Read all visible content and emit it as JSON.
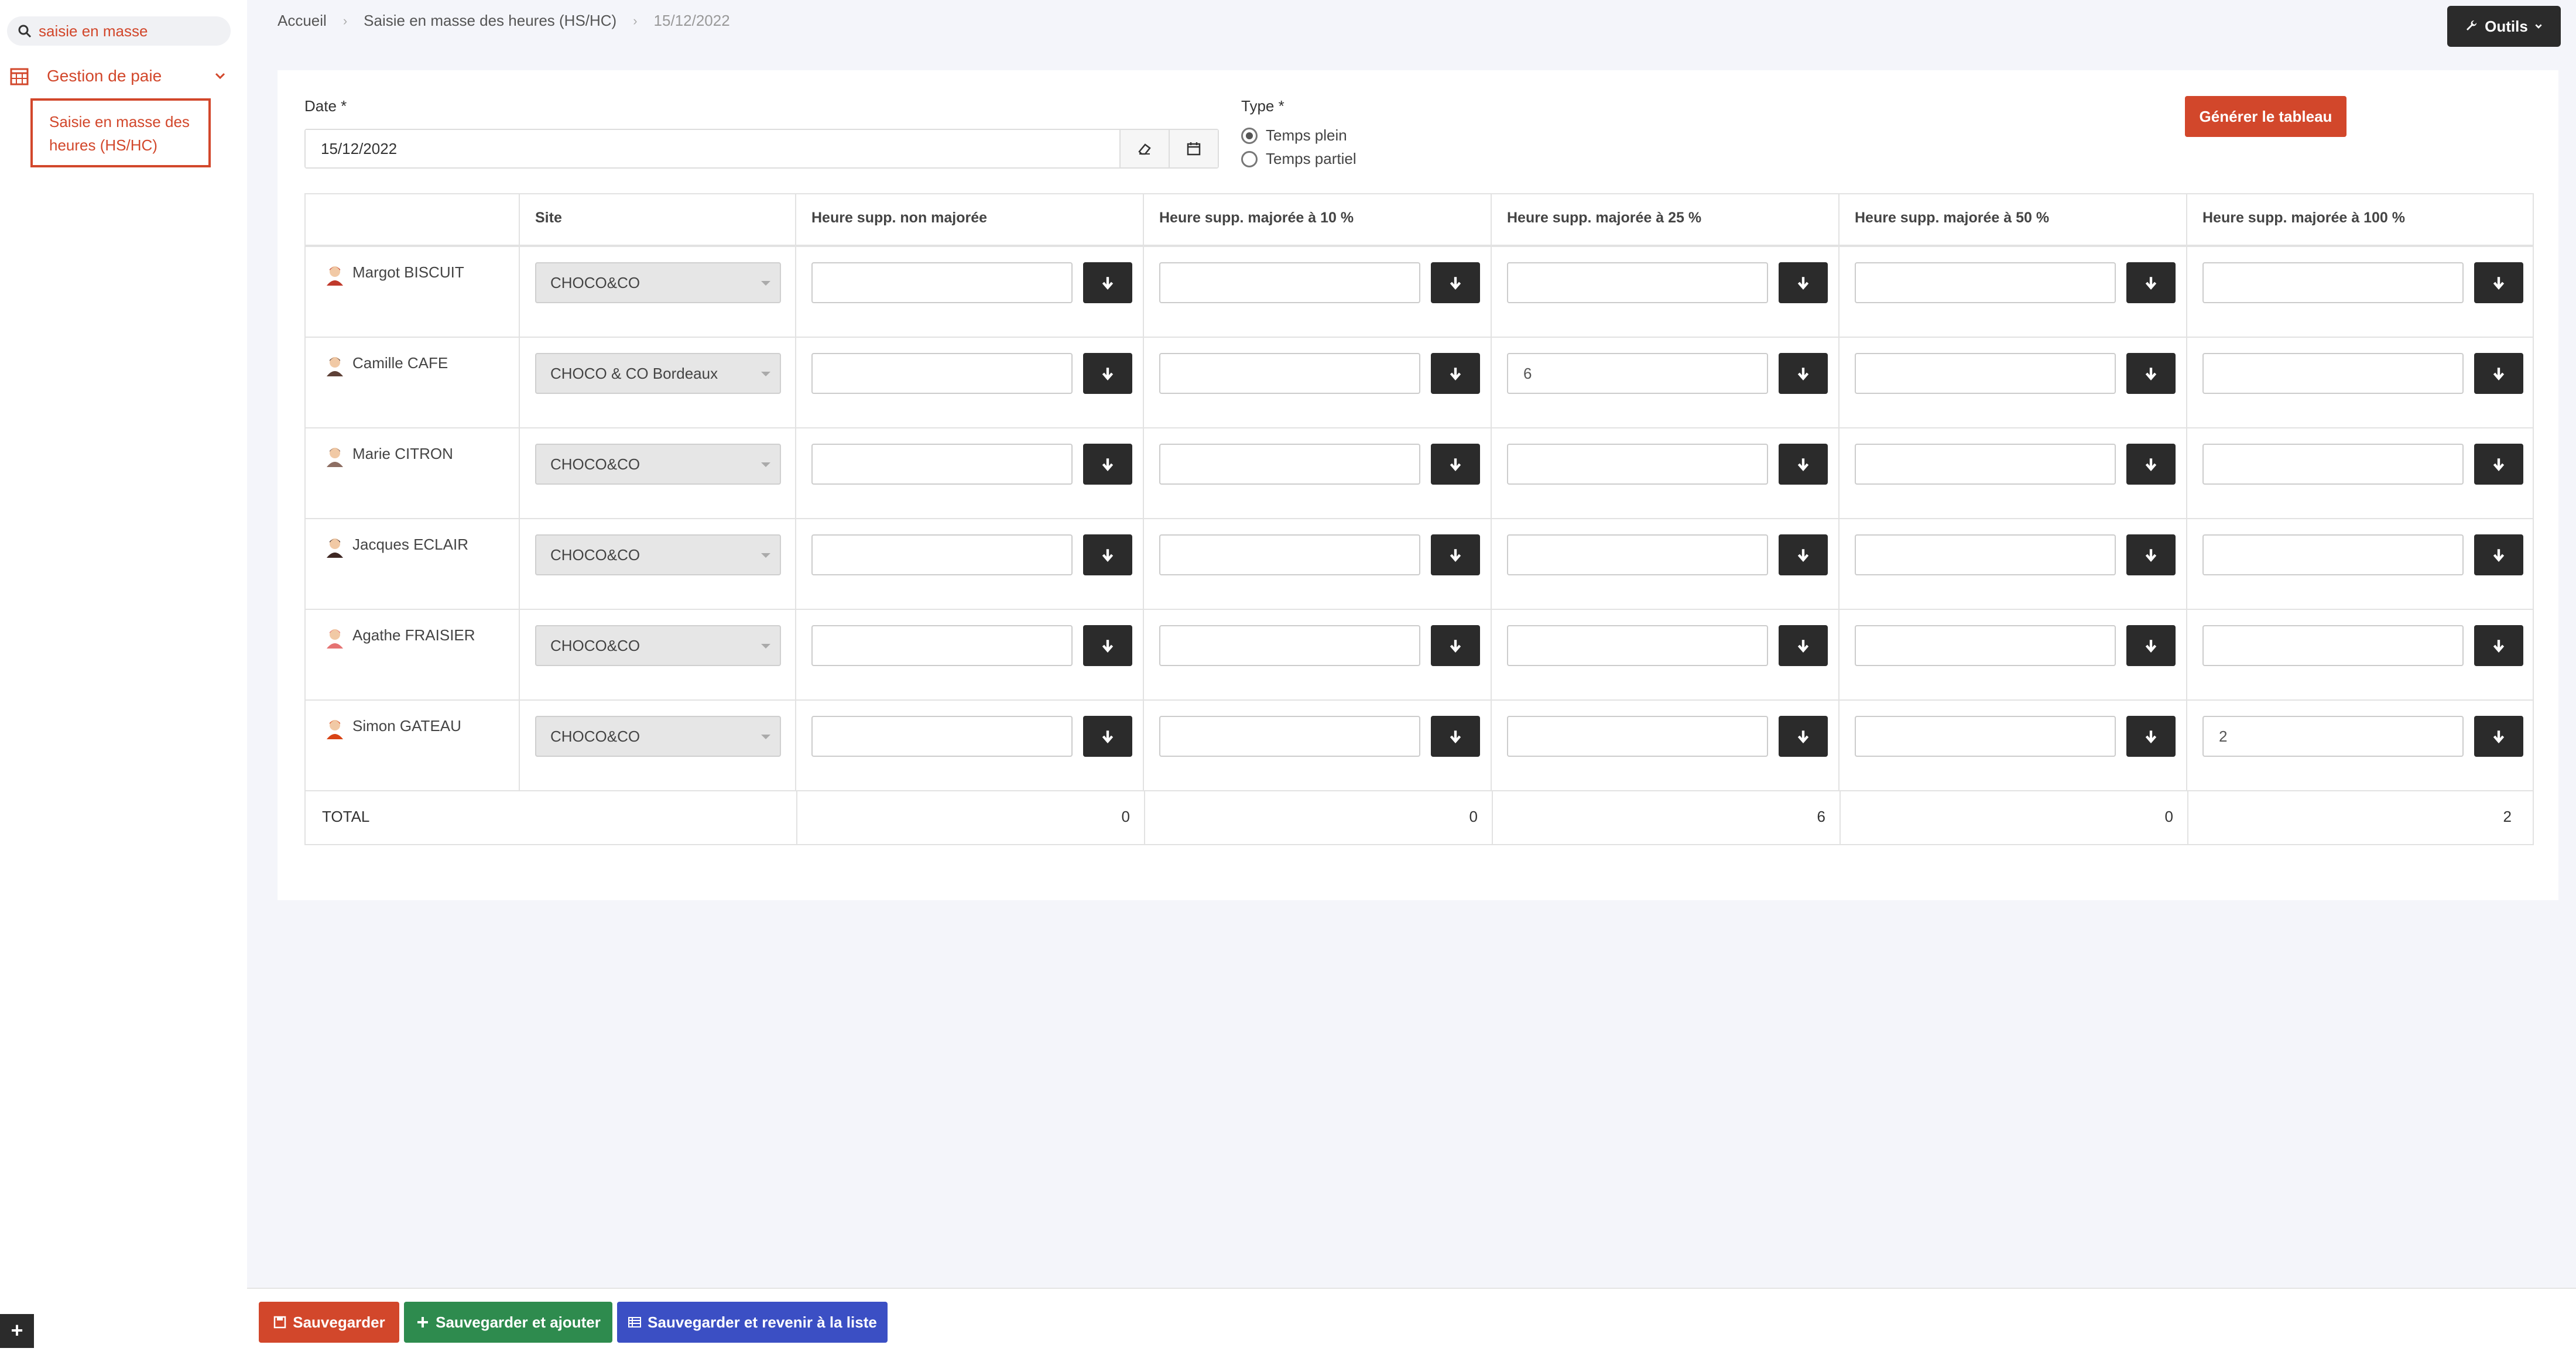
{
  "sidebar": {
    "search_value": "saisie en masse",
    "group_label": "Gestion de paie",
    "active_item_line1": "Saisie en masse des",
    "active_item_line2": "heures (HS/HC)",
    "plus_label": "+"
  },
  "breadcrumb": [
    "Accueil",
    "Saisie en masse des heures (HS/HC)",
    "15/12/2022"
  ],
  "tools_label": "Outils",
  "form": {
    "date_label": "Date *",
    "date_value": "15/12/2022",
    "type_label": "Type *",
    "type_options": [
      "Temps plein",
      "Temps partiel"
    ],
    "type_selected": "Temps plein",
    "generate_label": "Générer le tableau"
  },
  "table": {
    "headers": [
      "",
      "Site",
      "Heure supp. non majorée",
      "Heure supp. majorée à 10 %",
      "Heure supp. majorée à 25 %",
      "Heure supp. majorée à 50 %",
      "Heure supp. majorée à 100 %"
    ],
    "rows": [
      {
        "name": "Margot BISCUIT",
        "site": "CHOCO&CO",
        "values": [
          "",
          "",
          "",
          "",
          ""
        ]
      },
      {
        "name": "Camille CAFE",
        "site": "CHOCO & CO Bordeaux",
        "values": [
          "",
          "",
          "6",
          "",
          ""
        ]
      },
      {
        "name": "Marie CITRON",
        "site": "CHOCO&CO",
        "values": [
          "",
          "",
          "",
          "",
          ""
        ]
      },
      {
        "name": "Jacques ECLAIR",
        "site": "CHOCO&CO",
        "values": [
          "",
          "",
          "",
          "",
          ""
        ]
      },
      {
        "name": "Agathe FRAISIER",
        "site": "CHOCO&CO",
        "values": [
          "",
          "",
          "",
          "",
          ""
        ]
      },
      {
        "name": "Simon GATEAU",
        "site": "CHOCO&CO",
        "values": [
          "",
          "",
          "",
          "",
          "2"
        ]
      }
    ],
    "total_label": "TOTAL",
    "totals": [
      "0",
      "0",
      "6",
      "0",
      "2"
    ]
  },
  "footer": {
    "save_label": "Sauvegarder",
    "save_add_label": "Sauvegarder et ajouter",
    "save_back_label": "Sauvegarder et revenir à la liste"
  },
  "colors": {
    "accent": "#d2472b",
    "dark_button": "#2b2b2b",
    "save_add": "#2e8b4e",
    "save_back": "#3b4fc4"
  }
}
